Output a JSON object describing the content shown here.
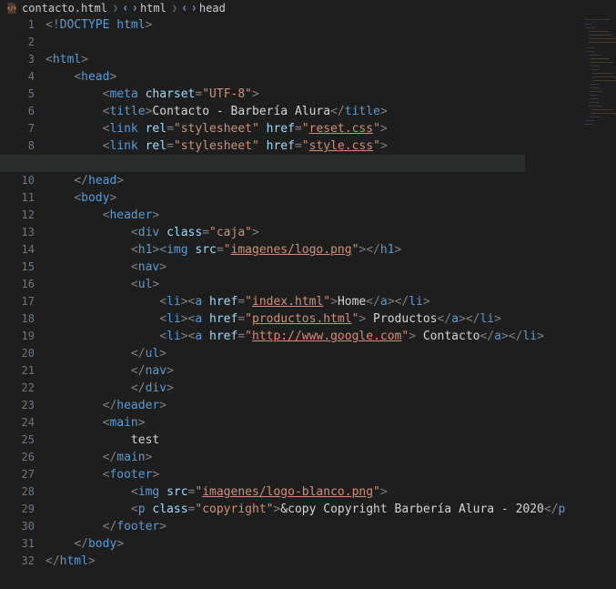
{
  "breadcrumb": {
    "file": "contacto.html",
    "seg1": "html",
    "seg2": "head"
  },
  "lines": [
    {
      "n": "1",
      "parts": [
        [
          "pun",
          "<"
        ],
        [
          "doct",
          "!"
        ],
        [
          "doctk",
          "DOCTYPE "
        ],
        [
          "doctk",
          "html"
        ],
        [
          "pun",
          ">"
        ]
      ]
    },
    {
      "n": "2",
      "parts": []
    },
    {
      "n": "3",
      "parts": [
        [
          "pun",
          "<"
        ],
        [
          "tag",
          "html"
        ],
        [
          "pun",
          ">"
        ]
      ]
    },
    {
      "n": "4",
      "parts": [
        [
          "text",
          "    "
        ],
        [
          "pun",
          "<"
        ],
        [
          "tag",
          "head"
        ],
        [
          "pun",
          ">"
        ]
      ]
    },
    {
      "n": "5",
      "parts": [
        [
          "text",
          "        "
        ],
        [
          "pun",
          "<"
        ],
        [
          "tag",
          "meta"
        ],
        [
          "text",
          " "
        ],
        [
          "attr",
          "charset"
        ],
        [
          "pun",
          "="
        ],
        [
          "str",
          "\"UTF-8\""
        ],
        [
          "pun",
          ">"
        ]
      ]
    },
    {
      "n": "6",
      "parts": [
        [
          "text",
          "        "
        ],
        [
          "pun",
          "<"
        ],
        [
          "tag",
          "title"
        ],
        [
          "pun",
          ">"
        ],
        [
          "text",
          "Contacto - Barbería Alura"
        ],
        [
          "pun",
          "</"
        ],
        [
          "tag",
          "title"
        ],
        [
          "pun",
          ">"
        ]
      ]
    },
    {
      "n": "7",
      "parts": [
        [
          "text",
          "        "
        ],
        [
          "pun",
          "<"
        ],
        [
          "tag",
          "link"
        ],
        [
          "text",
          " "
        ],
        [
          "attr",
          "rel"
        ],
        [
          "pun",
          "="
        ],
        [
          "str",
          "\"stylesheet\""
        ],
        [
          "text",
          " "
        ],
        [
          "attr",
          "href"
        ],
        [
          "pun",
          "="
        ],
        [
          "str",
          "\""
        ],
        [
          "lnk",
          "reset.css"
        ],
        [
          "str",
          "\""
        ],
        [
          "pun",
          ">"
        ]
      ]
    },
    {
      "n": "8",
      "parts": [
        [
          "text",
          "        "
        ],
        [
          "pun",
          "<"
        ],
        [
          "tag",
          "link"
        ],
        [
          "text",
          " "
        ],
        [
          "attr",
          "rel"
        ],
        [
          "pun",
          "="
        ],
        [
          "str",
          "\"stylesheet\""
        ],
        [
          "text",
          " "
        ],
        [
          "attr",
          "href"
        ],
        [
          "pun",
          "="
        ],
        [
          "str",
          "\""
        ],
        [
          "lnk",
          "style.css"
        ],
        [
          "str",
          "\""
        ],
        [
          "pun",
          ">"
        ]
      ]
    },
    {
      "n": "9",
      "parts": [
        [
          "text",
          "        "
        ]
      ],
      "cur": true
    },
    {
      "n": "10",
      "parts": [
        [
          "text",
          "    "
        ],
        [
          "pun",
          "</"
        ],
        [
          "tag",
          "head"
        ],
        [
          "pun",
          ">"
        ]
      ]
    },
    {
      "n": "11",
      "parts": [
        [
          "text",
          "    "
        ],
        [
          "pun",
          "<"
        ],
        [
          "tag",
          "body"
        ],
        [
          "pun",
          ">"
        ]
      ]
    },
    {
      "n": "12",
      "parts": [
        [
          "text",
          "        "
        ],
        [
          "pun",
          "<"
        ],
        [
          "tag",
          "header"
        ],
        [
          "pun",
          ">"
        ]
      ]
    },
    {
      "n": "13",
      "parts": [
        [
          "text",
          "            "
        ],
        [
          "pun",
          "<"
        ],
        [
          "tag",
          "div"
        ],
        [
          "text",
          " "
        ],
        [
          "attr",
          "class"
        ],
        [
          "pun",
          "="
        ],
        [
          "str",
          "\"caja\""
        ],
        [
          "pun",
          ">"
        ]
      ]
    },
    {
      "n": "14",
      "parts": [
        [
          "text",
          "            "
        ],
        [
          "pun",
          "<"
        ],
        [
          "tag",
          "h1"
        ],
        [
          "pun",
          ">"
        ],
        [
          "pun",
          "<"
        ],
        [
          "tag",
          "img"
        ],
        [
          "text",
          " "
        ],
        [
          "attr",
          "src"
        ],
        [
          "pun",
          "="
        ],
        [
          "str",
          "\""
        ],
        [
          "lnk",
          "imagenes/logo.png"
        ],
        [
          "str",
          "\""
        ],
        [
          "pun",
          ">"
        ],
        [
          "pun",
          "</"
        ],
        [
          "tag",
          "h1"
        ],
        [
          "pun",
          ">"
        ]
      ]
    },
    {
      "n": "15",
      "parts": [
        [
          "text",
          "            "
        ],
        [
          "pun",
          "<"
        ],
        [
          "tag",
          "nav"
        ],
        [
          "pun",
          ">"
        ]
      ]
    },
    {
      "n": "16",
      "parts": [
        [
          "text",
          "            "
        ],
        [
          "pun",
          "<"
        ],
        [
          "tag",
          "ul"
        ],
        [
          "pun",
          ">"
        ]
      ]
    },
    {
      "n": "17",
      "parts": [
        [
          "text",
          "                "
        ],
        [
          "pun",
          "<"
        ],
        [
          "tag",
          "li"
        ],
        [
          "pun",
          ">"
        ],
        [
          "pun",
          "<"
        ],
        [
          "tag",
          "a"
        ],
        [
          "text",
          " "
        ],
        [
          "attr",
          "href"
        ],
        [
          "pun",
          "="
        ],
        [
          "str",
          "\""
        ],
        [
          "lnk",
          "index.html"
        ],
        [
          "str",
          "\""
        ],
        [
          "pun",
          ">"
        ],
        [
          "text",
          "Home"
        ],
        [
          "pun",
          "</"
        ],
        [
          "tag",
          "a"
        ],
        [
          "pun",
          ">"
        ],
        [
          "pun",
          "</"
        ],
        [
          "tag",
          "li"
        ],
        [
          "pun",
          ">"
        ]
      ]
    },
    {
      "n": "18",
      "parts": [
        [
          "text",
          "                "
        ],
        [
          "pun",
          "<"
        ],
        [
          "tag",
          "li"
        ],
        [
          "pun",
          ">"
        ],
        [
          "pun",
          "<"
        ],
        [
          "tag",
          "a"
        ],
        [
          "text",
          " "
        ],
        [
          "attr",
          "href"
        ],
        [
          "pun",
          "="
        ],
        [
          "str",
          "\""
        ],
        [
          "lnk",
          "productos.html"
        ],
        [
          "str",
          "\""
        ],
        [
          "pun",
          ">"
        ],
        [
          "text",
          " Productos"
        ],
        [
          "pun",
          "</"
        ],
        [
          "tag",
          "a"
        ],
        [
          "pun",
          ">"
        ],
        [
          "pun",
          "</"
        ],
        [
          "tag",
          "li"
        ],
        [
          "pun",
          ">"
        ]
      ]
    },
    {
      "n": "19",
      "parts": [
        [
          "text",
          "                "
        ],
        [
          "pun",
          "<"
        ],
        [
          "tag",
          "li"
        ],
        [
          "pun",
          ">"
        ],
        [
          "pun",
          "<"
        ],
        [
          "tag",
          "a"
        ],
        [
          "text",
          " "
        ],
        [
          "attr",
          "href"
        ],
        [
          "pun",
          "="
        ],
        [
          "str",
          "\""
        ],
        [
          "lnk",
          "http://www.google.com"
        ],
        [
          "str",
          "\""
        ],
        [
          "pun",
          ">"
        ],
        [
          "text",
          " Contacto"
        ],
        [
          "pun",
          "</"
        ],
        [
          "tag",
          "a"
        ],
        [
          "pun",
          ">"
        ],
        [
          "pun",
          "</"
        ],
        [
          "tag",
          "li"
        ],
        [
          "pun",
          ">"
        ]
      ]
    },
    {
      "n": "20",
      "parts": [
        [
          "text",
          "            "
        ],
        [
          "pun",
          "</"
        ],
        [
          "tag",
          "ul"
        ],
        [
          "pun",
          ">"
        ]
      ]
    },
    {
      "n": "21",
      "parts": [
        [
          "text",
          "            "
        ],
        [
          "pun",
          "</"
        ],
        [
          "tag",
          "nav"
        ],
        [
          "pun",
          ">"
        ]
      ]
    },
    {
      "n": "22",
      "parts": [
        [
          "text",
          "            "
        ],
        [
          "pun",
          "</"
        ],
        [
          "tag",
          "div"
        ],
        [
          "pun",
          ">"
        ]
      ]
    },
    {
      "n": "23",
      "parts": [
        [
          "text",
          "        "
        ],
        [
          "pun",
          "</"
        ],
        [
          "tag",
          "header"
        ],
        [
          "pun",
          ">"
        ]
      ]
    },
    {
      "n": "24",
      "parts": [
        [
          "text",
          "        "
        ],
        [
          "pun",
          "<"
        ],
        [
          "tag",
          "main"
        ],
        [
          "pun",
          ">"
        ]
      ]
    },
    {
      "n": "25",
      "parts": [
        [
          "text",
          "            test"
        ]
      ]
    },
    {
      "n": "26",
      "parts": [
        [
          "text",
          "        "
        ],
        [
          "pun",
          "</"
        ],
        [
          "tag",
          "main"
        ],
        [
          "pun",
          ">"
        ]
      ]
    },
    {
      "n": "27",
      "parts": [
        [
          "text",
          "        "
        ],
        [
          "pun",
          "<"
        ],
        [
          "tag",
          "footer"
        ],
        [
          "pun",
          ">"
        ]
      ]
    },
    {
      "n": "28",
      "parts": [
        [
          "text",
          "            "
        ],
        [
          "pun",
          "<"
        ],
        [
          "tag",
          "img"
        ],
        [
          "text",
          " "
        ],
        [
          "attr",
          "src"
        ],
        [
          "pun",
          "="
        ],
        [
          "str",
          "\""
        ],
        [
          "lnk",
          "imagenes/logo-blanco.png"
        ],
        [
          "str",
          "\""
        ],
        [
          "pun",
          ">"
        ]
      ]
    },
    {
      "n": "29",
      "parts": [
        [
          "text",
          "            "
        ],
        [
          "pun",
          "<"
        ],
        [
          "tag",
          "p"
        ],
        [
          "text",
          " "
        ],
        [
          "attr",
          "class"
        ],
        [
          "pun",
          "="
        ],
        [
          "str",
          "\"copyright\""
        ],
        [
          "pun",
          ">"
        ],
        [
          "text",
          "&copy Copyright Barbería Alura - 2020"
        ],
        [
          "pun",
          "</"
        ],
        [
          "tag",
          "p"
        ]
      ]
    },
    {
      "n": "30",
      "parts": [
        [
          "text",
          "        "
        ],
        [
          "pun",
          "</"
        ],
        [
          "tag",
          "footer"
        ],
        [
          "pun",
          ">"
        ]
      ]
    },
    {
      "n": "31",
      "parts": [
        [
          "text",
          "    "
        ],
        [
          "pun",
          "</"
        ],
        [
          "tag",
          "body"
        ],
        [
          "pun",
          ">"
        ]
      ]
    },
    {
      "n": "32",
      "parts": [
        [
          "pun",
          "</"
        ],
        [
          "tag",
          "html"
        ],
        [
          "pun",
          ">"
        ]
      ]
    }
  ]
}
